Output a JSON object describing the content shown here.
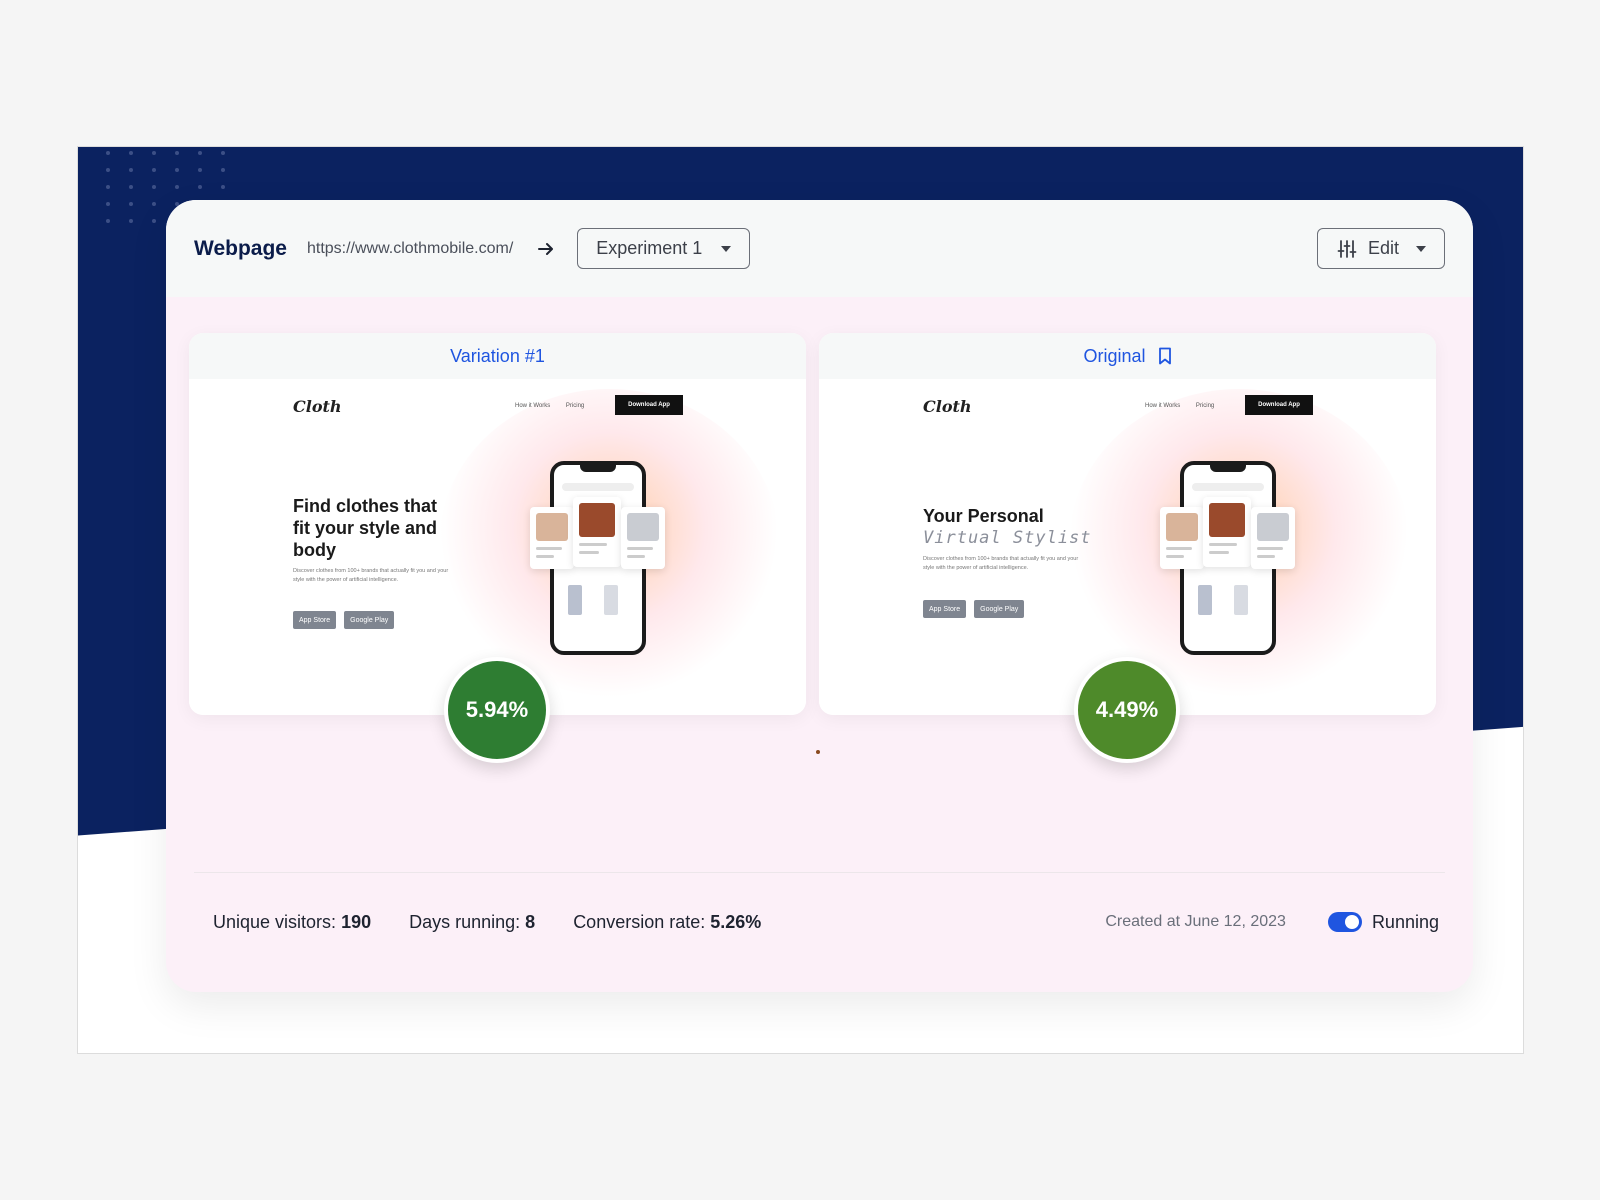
{
  "header": {
    "title": "Webpage",
    "url": "https://www.clothmobile.com/",
    "experiment_select": "Experiment 1",
    "edit_label": "Edit"
  },
  "variants": [
    {
      "label": "Variation #1",
      "conversion": "5.94%",
      "badge_color": "#2e7d32",
      "preview": {
        "logo": "Cloth",
        "nav": [
          "How it Works",
          "Pricing"
        ],
        "cta": "Download App",
        "headline_lines": [
          "Find clothes that",
          "fit your style and",
          "body"
        ],
        "subcopy": "Discover clothes from 100+ brands that actually fit you and your style with the power of artificial intelligence.",
        "store_buttons": [
          "App Store",
          "Google Play"
        ]
      }
    },
    {
      "label": "Original",
      "conversion": "4.49%",
      "badge_color": "#4e8a2a",
      "preview": {
        "logo": "Cloth",
        "nav": [
          "How it Works",
          "Pricing"
        ],
        "cta": "Download App",
        "headline_lines": [
          "Your Personal",
          "Virtual Stylist"
        ],
        "subcopy": "Discover clothes from 100+ brands that actually fit you and your style with the power of artificial intelligence.",
        "store_buttons": [
          "App Store",
          "Google Play"
        ]
      }
    }
  ],
  "stats": {
    "unique_visitors_label": "Unique visitors:",
    "unique_visitors": "190",
    "days_running_label": "Days running:",
    "days_running": "8",
    "conversion_rate_label": "Conversion rate:",
    "conversion_rate": "5.26%",
    "created": "Created at June 12, 2023",
    "status": "Running",
    "status_on": true
  },
  "colors": {
    "navy": "#0b2260",
    "accent": "#1f55e0",
    "card_bg": "#fcf0f8"
  },
  "icons": [
    "arrow-right-icon",
    "caret-down-icon",
    "sliders-icon",
    "bookmark-icon"
  ]
}
